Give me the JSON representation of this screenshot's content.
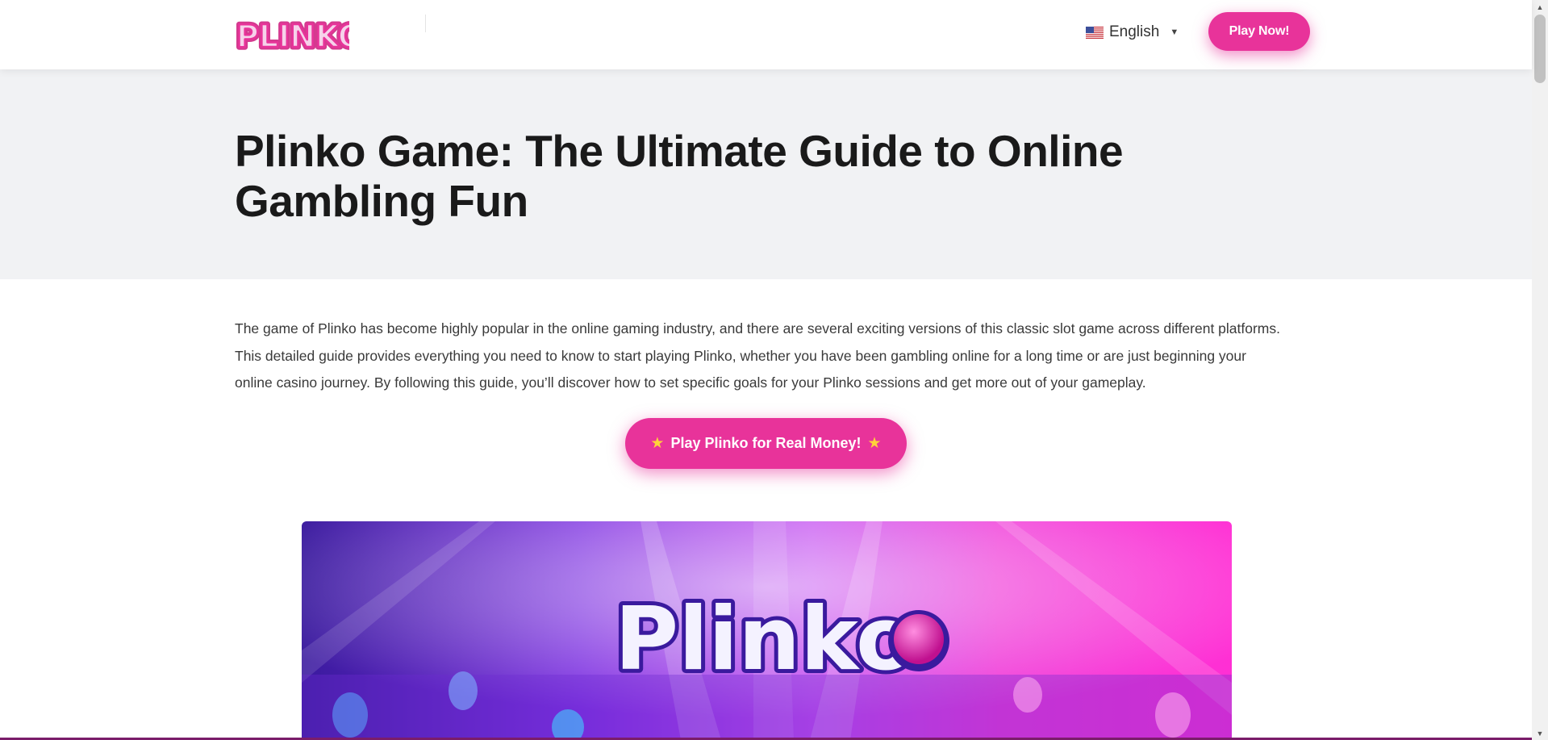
{
  "header": {
    "logo_text": "PLINKO",
    "language": "English",
    "play_now_label": "Play Now!"
  },
  "hero": {
    "title": "Plinko Game: The Ultimate Guide to Online Gambling Fun"
  },
  "main": {
    "intro": "The game of Plinko has become highly popular in the online gaming industry, and there are several exciting versions of this classic slot game across different platforms. This detailed guide provides everything you need to know to start playing Plinko, whether you have been gambling online for a long time or are just beginning your online casino journey. By following this guide, you’ll discover how to set specific goals for your Plinko sessions and get more out of your gameplay.",
    "cta_label": "Play Plinko for Real Money!",
    "banner_text": "Plinko"
  },
  "colors": {
    "accent": "#e8339a",
    "hero_bg": "#f1f2f4",
    "text_dark": "#1a1a1a"
  },
  "icons": {
    "flag": "us-flag-icon",
    "caret": "caret-down-icon",
    "star": "star-icon"
  }
}
